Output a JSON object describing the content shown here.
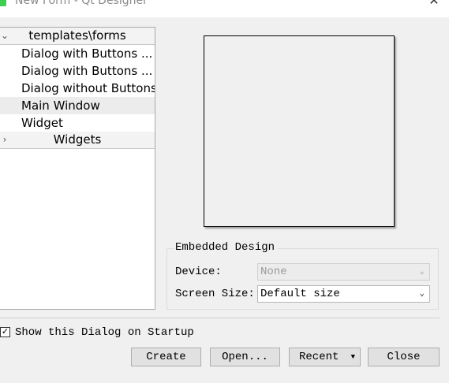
{
  "window": {
    "title": "New Form - Qt Designer"
  },
  "tree": {
    "categories": [
      {
        "label": "templates\\forms",
        "expanded": true
      },
      {
        "label": "Widgets",
        "expanded": false
      }
    ],
    "items": [
      {
        "label": "Dialog with Buttons ..."
      },
      {
        "label": "Dialog with Buttons ..."
      },
      {
        "label": "Dialog without Buttons"
      },
      {
        "label": "Main Window",
        "selected": true
      },
      {
        "label": "Widget"
      }
    ]
  },
  "embedded": {
    "title": "Embedded Design",
    "device_label": "Device:",
    "device_value": "None",
    "screen_size_label": "Screen Size:",
    "screen_size_value": "Default size"
  },
  "startup": {
    "label": "Show this Dialog on Startup",
    "checked": true
  },
  "buttons": {
    "create": "Create",
    "open": "Open...",
    "recent": "Recent",
    "close": "Close"
  },
  "icons": {
    "app": "qt-designer-icon",
    "close": "close-icon",
    "expand": "chevron-down-icon",
    "collapse": "chevron-right-icon",
    "dropdown": "chevron-down-icon",
    "check": "checkmark-icon"
  }
}
